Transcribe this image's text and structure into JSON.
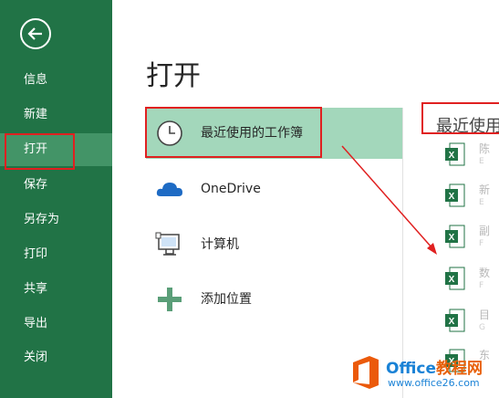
{
  "sidebar": {
    "items": [
      {
        "label": "信息"
      },
      {
        "label": "新建"
      },
      {
        "label": "打开"
      },
      {
        "label": "保存"
      },
      {
        "label": "另存为"
      },
      {
        "label": "打印"
      },
      {
        "label": "共享"
      },
      {
        "label": "导出"
      },
      {
        "label": "关闭"
      }
    ]
  },
  "main": {
    "title": "打开",
    "places": [
      {
        "label": "最近使用的工作簿",
        "icon": "clock-icon"
      },
      {
        "label": "OneDrive",
        "icon": "cloud-icon"
      },
      {
        "label": "计算机",
        "icon": "computer-icon"
      },
      {
        "label": "添加位置",
        "icon": "plus-icon"
      }
    ]
  },
  "recent": {
    "title": "最近使用",
    "files": [
      {
        "name": "陈",
        "path": "E"
      },
      {
        "name": "新",
        "path": "E"
      },
      {
        "name": "副",
        "path": "F"
      },
      {
        "name": "数",
        "path": "F"
      },
      {
        "name": "目",
        "path": "G"
      },
      {
        "name": "东",
        "path": ""
      }
    ]
  },
  "watermark": {
    "name_en": "Office",
    "name_cn": "教程网",
    "url": "www.office26.com"
  },
  "colors": {
    "sidebar": "#217346",
    "sidebar_active": "#439467",
    "selected_place": "#a3d7bb",
    "highlight": "#e02020",
    "excel_icon": "#217346"
  }
}
